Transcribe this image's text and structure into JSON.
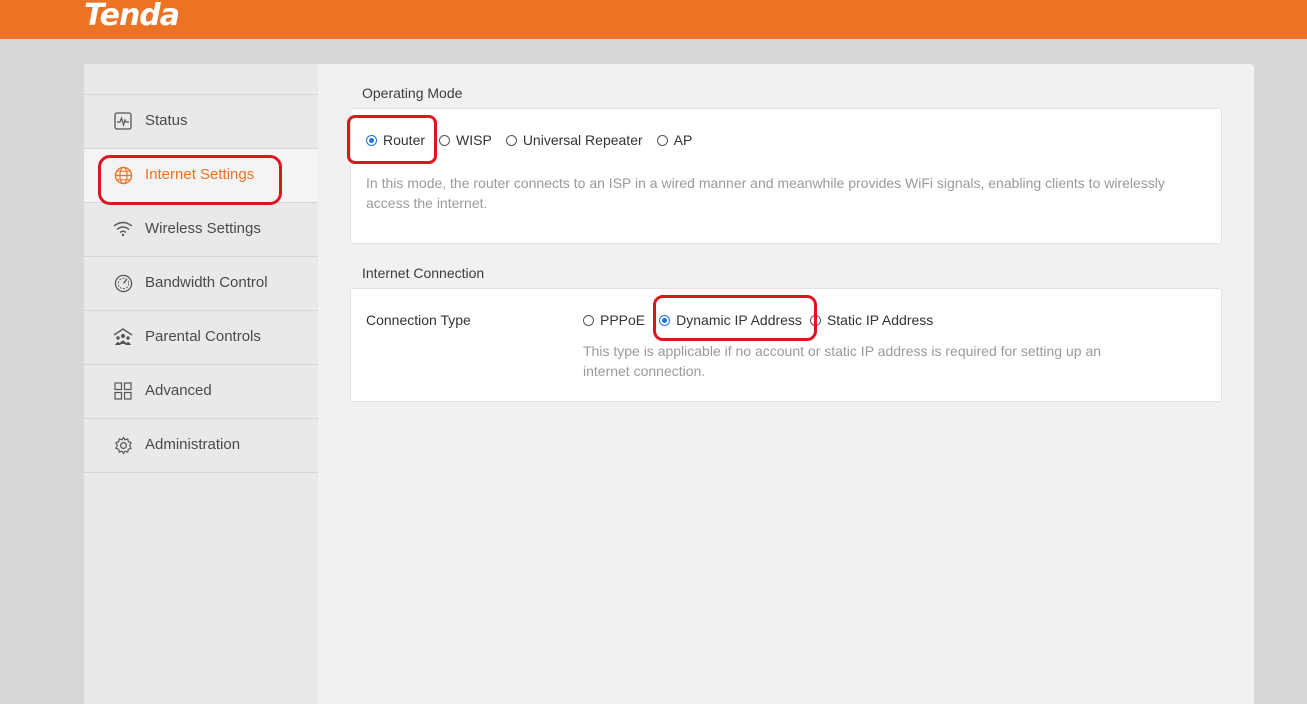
{
  "brand": {
    "logo_text": "Tenda",
    "accent_color": "#ee7223"
  },
  "sidebar": {
    "items": [
      {
        "label": "Status",
        "icon": "status-chart-icon",
        "active": false
      },
      {
        "label": "Internet Settings",
        "icon": "globe-icon",
        "active": true
      },
      {
        "label": "Wireless Settings",
        "icon": "wifi-icon",
        "active": false
      },
      {
        "label": "Bandwidth Control",
        "icon": "speedometer-icon",
        "active": false
      },
      {
        "label": "Parental Controls",
        "icon": "family-icon",
        "active": false
      },
      {
        "label": "Advanced",
        "icon": "grid-icon",
        "active": false
      },
      {
        "label": "Administration",
        "icon": "gear-icon",
        "active": false
      }
    ]
  },
  "operating_mode": {
    "title": "Operating Mode",
    "options": [
      "Router",
      "WISP",
      "Universal Repeater",
      "AP"
    ],
    "selected": "Router",
    "description": "In this mode, the router connects to an ISP in a wired manner and meanwhile provides WiFi signals, enabling clients to wirelessly access the internet."
  },
  "internet_connection": {
    "title": "Internet Connection",
    "connection_type_label": "Connection Type",
    "options": [
      "PPPoE",
      "Dynamic IP Address",
      "Static IP Address"
    ],
    "selected": "Dynamic IP Address",
    "description": "This type is applicable if no account or static IP address is required for setting up an internet connection."
  },
  "annotation_color": "#e0141e"
}
